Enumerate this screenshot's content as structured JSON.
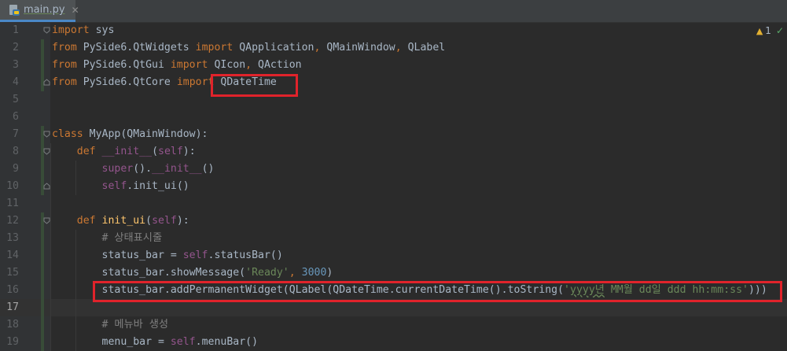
{
  "tab": {
    "title": "main.py",
    "close_glyph": "✕",
    "icon": "python-file-icon"
  },
  "inspections": {
    "warning_count": "1",
    "warning_glyph": "▲",
    "ok_glyph": "✓"
  },
  "lines": [
    {
      "num": "1",
      "tokens": [
        {
          "t": "import",
          "c": "kw"
        },
        {
          "t": " sys",
          "c": "plain"
        }
      ]
    },
    {
      "num": "2",
      "tokens": [
        {
          "t": "from",
          "c": "kw"
        },
        {
          "t": " PySide6.QtWidgets ",
          "c": "plain"
        },
        {
          "t": "import",
          "c": "kw"
        },
        {
          "t": " QApplication",
          "c": "plain"
        },
        {
          "t": ",",
          "c": "kw"
        },
        {
          "t": " QMainWindow",
          "c": "plain"
        },
        {
          "t": ",",
          "c": "kw"
        },
        {
          "t": " QLabel",
          "c": "plain"
        }
      ]
    },
    {
      "num": "3",
      "tokens": [
        {
          "t": "from",
          "c": "kw"
        },
        {
          "t": " PySide6.QtGui ",
          "c": "plain"
        },
        {
          "t": "import",
          "c": "kw"
        },
        {
          "t": " QIcon",
          "c": "plain"
        },
        {
          "t": ",",
          "c": "kw"
        },
        {
          "t": " QAction",
          "c": "plain"
        }
      ]
    },
    {
      "num": "4",
      "tokens": [
        {
          "t": "from",
          "c": "kw"
        },
        {
          "t": " PySide6.QtCore ",
          "c": "plain"
        },
        {
          "t": "import",
          "c": "kw"
        },
        {
          "t": " QDateTime",
          "c": "plain"
        }
      ]
    },
    {
      "num": "5",
      "tokens": []
    },
    {
      "num": "6",
      "tokens": []
    },
    {
      "num": "7",
      "tokens": [
        {
          "t": "class",
          "c": "kw"
        },
        {
          "t": " MyApp(QMainWindow):",
          "c": "plain"
        }
      ]
    },
    {
      "num": "8",
      "tokens": [
        {
          "t": "    ",
          "c": "plain"
        },
        {
          "t": "def",
          "c": "kw"
        },
        {
          "t": " ",
          "c": "plain"
        },
        {
          "t": "__init__",
          "c": "self"
        },
        {
          "t": "(",
          "c": "plain"
        },
        {
          "t": "self",
          "c": "self"
        },
        {
          "t": "):",
          "c": "plain"
        }
      ]
    },
    {
      "num": "9",
      "tokens": [
        {
          "t": "        ",
          "c": "plain"
        },
        {
          "t": "super",
          "c": "self"
        },
        {
          "t": "().",
          "c": "plain"
        },
        {
          "t": "__init__",
          "c": "self"
        },
        {
          "t": "()",
          "c": "plain"
        }
      ]
    },
    {
      "num": "10",
      "tokens": [
        {
          "t": "        ",
          "c": "plain"
        },
        {
          "t": "self",
          "c": "self"
        },
        {
          "t": ".init_ui()",
          "c": "plain"
        }
      ]
    },
    {
      "num": "11",
      "tokens": []
    },
    {
      "num": "12",
      "tokens": [
        {
          "t": "    ",
          "c": "plain"
        },
        {
          "t": "def",
          "c": "kw"
        },
        {
          "t": " ",
          "c": "plain"
        },
        {
          "t": "init_ui",
          "c": "fn"
        },
        {
          "t": "(",
          "c": "plain"
        },
        {
          "t": "self",
          "c": "self"
        },
        {
          "t": "):",
          "c": "plain"
        }
      ]
    },
    {
      "num": "13",
      "tokens": [
        {
          "t": "        ",
          "c": "plain"
        },
        {
          "t": "# 상태표시줄",
          "c": "cmt"
        }
      ]
    },
    {
      "num": "14",
      "tokens": [
        {
          "t": "        status_bar = ",
          "c": "plain"
        },
        {
          "t": "self",
          "c": "self"
        },
        {
          "t": ".statusBar()",
          "c": "plain"
        }
      ]
    },
    {
      "num": "15",
      "tokens": [
        {
          "t": "        status_bar.showMessage(",
          "c": "plain"
        },
        {
          "t": "'Ready'",
          "c": "str"
        },
        {
          "t": ",",
          "c": "kw"
        },
        {
          "t": " ",
          "c": "plain"
        },
        {
          "t": "3000",
          "c": "num"
        },
        {
          "t": ")",
          "c": "plain"
        }
      ]
    },
    {
      "num": "16",
      "tokens": [
        {
          "t": "        status_bar.addPermanentWidget(QLabel(QDateTime.currentDateTime().toString(",
          "c": "plain"
        },
        {
          "t": "'",
          "c": "str"
        },
        {
          "t": "yyyy년",
          "c": "str squig"
        },
        {
          "t": " MM월 dd일 ddd hh:mm:ss'",
          "c": "str"
        },
        {
          "t": ")))",
          "c": "plain"
        }
      ]
    },
    {
      "num": "17",
      "tokens": [],
      "current": true
    },
    {
      "num": "18",
      "tokens": [
        {
          "t": "        ",
          "c": "plain"
        },
        {
          "t": "# 메뉴바 생성",
          "c": "cmt"
        }
      ]
    },
    {
      "num": "19",
      "tokens": [
        {
          "t": "        menu_bar = ",
          "c": "plain"
        },
        {
          "t": "self",
          "c": "self"
        },
        {
          "t": ".menuBar()",
          "c": "plain"
        }
      ]
    }
  ]
}
